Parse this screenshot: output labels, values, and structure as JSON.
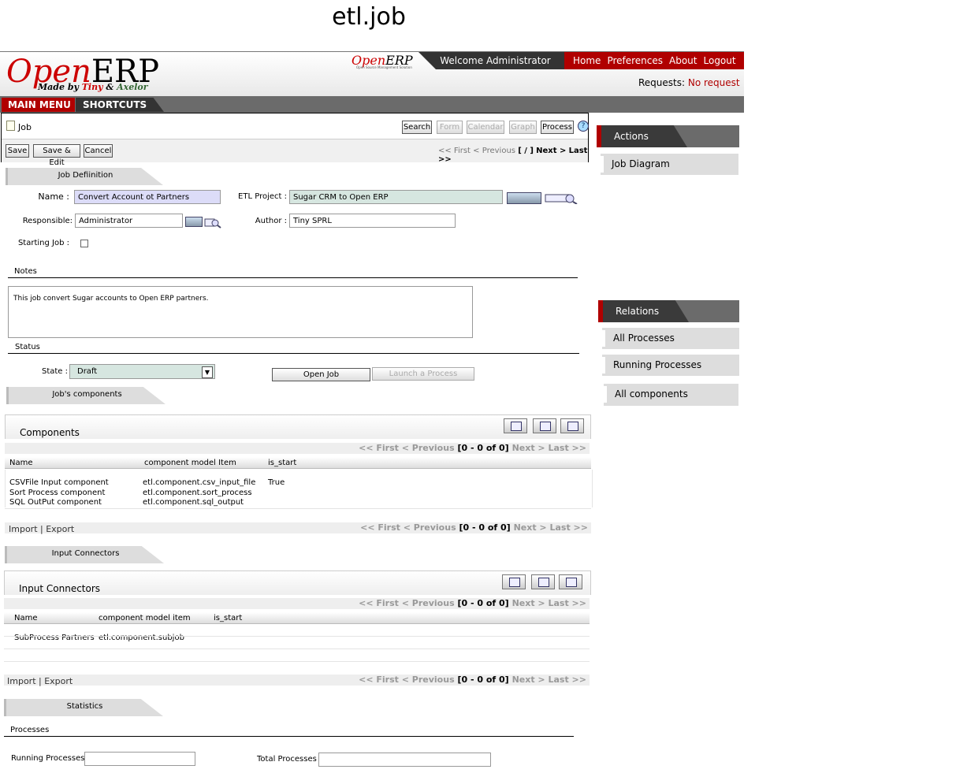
{
  "window_title": "etl.job",
  "header": {
    "logo_open": "Open",
    "logo_erp": "ERP",
    "logo_sub_prefix": "Made by",
    "logo_sub_tiny": "Tiny",
    "logo_sub_amp": "&",
    "logo_sub_axelor": "Axelor",
    "mini_logo_open": "Open",
    "mini_logo_erp": "ERP",
    "mini_logo_sub": "Open Source Management Solution",
    "welcome": "Welcome Administrator",
    "nav": [
      "Home",
      "Preferences",
      "About",
      "Logout"
    ],
    "requests_label": "Requests:",
    "requests_value": "No request"
  },
  "menubar": {
    "main_menu": "MAIN MENU",
    "shortcuts": "SHORTCUTS"
  },
  "toolbar": {
    "title": "Job",
    "views": [
      "Search",
      "Form",
      "Calendar",
      "Graph",
      "Process"
    ],
    "help": "?",
    "actions": [
      "Save",
      "Save & Edit",
      "Cancel"
    ],
    "pager": {
      "first": "<< First",
      "prev": "< Previous",
      "count": "[ / ]",
      "next": "Next >",
      "last": "Last >>"
    }
  },
  "sidebar": {
    "actions_title": "Actions",
    "actions": [
      "Job Diagram"
    ],
    "relations_title": "Relations",
    "relations": [
      "All Processes",
      "Running Processes",
      "All components"
    ]
  },
  "form": {
    "tab_definition": "Job Defiinition",
    "name_label": "Name :",
    "name_value": "Convert Account ot Partners",
    "project_label": "ETL Project :",
    "project_value": "Sugar CRM to Open ERP",
    "responsible_label": "Responsible:",
    "responsible_value": "Administrator",
    "author_label": "Author :",
    "author_value": "Tiny SPRL",
    "starting_label": "Starting Job :",
    "notes_label": "Notes",
    "notes_value": "This job convert Sugar accounts to Open ERP partners.",
    "status_label": "Status",
    "state_label": "State :",
    "state_value": "Draft",
    "open_job": "Open Job",
    "launch_process": "Launch a Process"
  },
  "components": {
    "tab": "Job's components",
    "title": "Components",
    "pager": {
      "first": "<< First",
      "prev": "< Previous",
      "count": "[0 - 0 of 0]",
      "next": "Next >",
      "last": "Last >>"
    },
    "columns": [
      "Name",
      "component model Item",
      "is_start"
    ],
    "rows": [
      [
        "CSVFile Input component",
        "etl.component.csv_input_file",
        "True"
      ],
      [
        "Sort Process component",
        "etl.component.sort_process",
        ""
      ],
      [
        "SQL OutPut component",
        "etl.component.sql_output",
        ""
      ]
    ],
    "import_export": "Import | Export"
  },
  "connectors": {
    "tab": "Input Connectors",
    "title": "Input Connectors",
    "pager": {
      "first": "<< First",
      "prev": "< Previous",
      "count": "[0 - 0 of 0]",
      "next": "Next >",
      "last": "Last >>"
    },
    "columns": [
      "Name",
      "component model item",
      "is_start"
    ],
    "rows": [
      [
        "SubProcess Partners",
        "etl.component.subjob",
        ""
      ]
    ],
    "import_export": "Import | Export"
  },
  "statistics": {
    "tab": "Statistics",
    "processes_label": "Processes",
    "running_label": "Running Processes :",
    "total_label": "Total Processes :"
  }
}
